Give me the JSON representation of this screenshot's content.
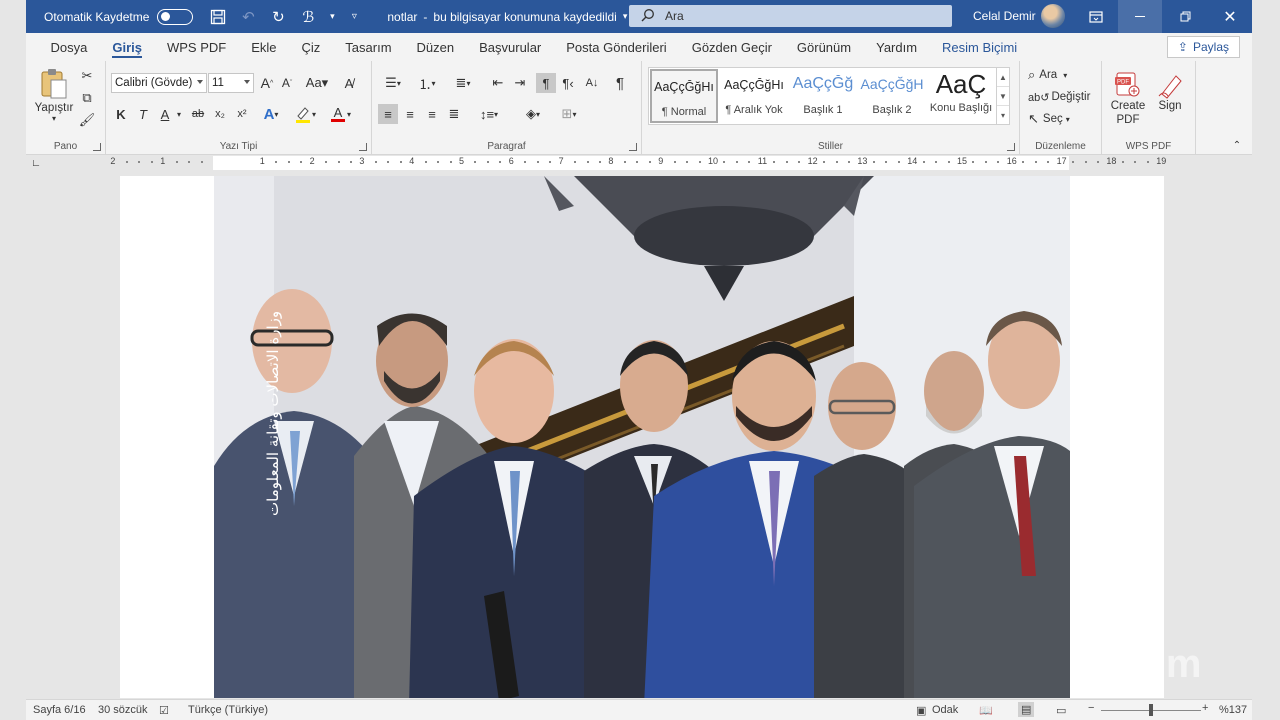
{
  "titlebar": {
    "autosave_label": "Otomatik Kaydetme",
    "doc_title": "notlar",
    "save_status": "bu bilgisayar konumuna kaydedildi",
    "search_placeholder": "Ara",
    "user_name": "Celal Demir"
  },
  "menu": {
    "tabs": [
      "Dosya",
      "Giriş",
      "WPS PDF",
      "Ekle",
      "Çiz",
      "Tasarım",
      "Düzen",
      "Başvurular",
      "Posta Gönderileri",
      "Gözden Geçir",
      "Görünüm",
      "Yardım",
      "Resim Biçimi"
    ],
    "active_tab": "Giriş",
    "share_label": "Paylaş"
  },
  "ribbon": {
    "clipboard": {
      "paste_label": "Yapıştır",
      "group_label": "Pano"
    },
    "font": {
      "font_name": "Calibri (Gövde)",
      "font_size": "11",
      "group_label": "Yazı Tipi",
      "bold": "K",
      "italic": "T",
      "underline": "A",
      "strike": "ab",
      "sub": "x₂",
      "sup": "x²"
    },
    "paragraph": {
      "group_label": "Paragraf"
    },
    "styles": {
      "group_label": "Stiller",
      "items": [
        {
          "sample": "AaÇçĞğHı",
          "name": "¶ Normal"
        },
        {
          "sample": "AaÇçĞğHı",
          "name": "¶ Aralık Yok"
        },
        {
          "sample": "AaÇçĞğ",
          "name": "Başlık 1"
        },
        {
          "sample": "AaÇçĞğH",
          "name": "Başlık 2"
        },
        {
          "sample": "AaÇ",
          "name": "Konu Başlığı"
        }
      ]
    },
    "editing": {
      "find_label": "Ara",
      "replace_label": "Değiştir",
      "select_label": "Seç",
      "group_label": "Düzenleme"
    },
    "wps": {
      "create_pdf_label": "Create PDF",
      "sign_label": "Sign",
      "group_label": "WPS PDF"
    }
  },
  "ruler": {
    "numbers": [
      "2",
      "1",
      "1",
      "2",
      "3",
      "4",
      "5",
      "6",
      "7",
      "8",
      "9",
      "10",
      "11",
      "12",
      "13",
      "14",
      "15",
      "16",
      "17",
      "18",
      "19"
    ]
  },
  "document": {
    "photo_caption": "وزارة الاتصالات وتقانة المعلومات",
    "watermark": "zoom"
  },
  "status": {
    "page": "Sayfa 6/16",
    "words": "30 sözcük",
    "language": "Türkçe (Türkiye)",
    "focus": "Odak",
    "zoom_level": "%137"
  },
  "colors": {
    "titlebar": "#2b579a",
    "accent": "#2b579a"
  }
}
